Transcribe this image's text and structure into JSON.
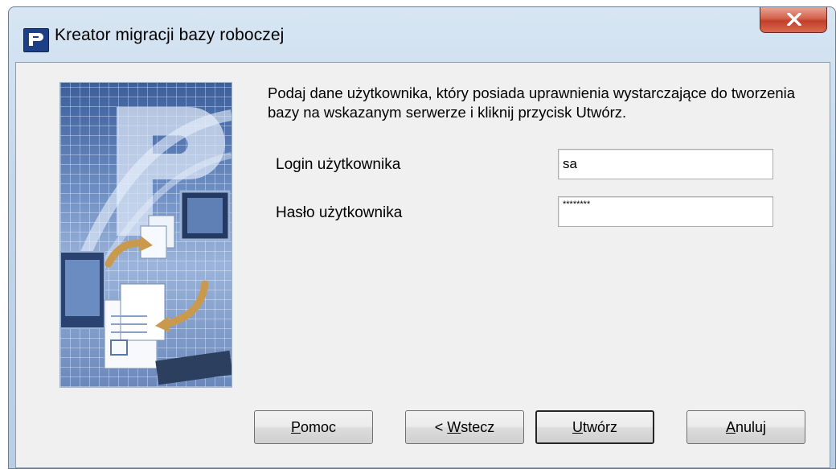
{
  "window": {
    "title": "Kreator migracji bazy roboczej",
    "close_label": "X"
  },
  "instructions": "Podaj dane użytkownika, który posiada uprawnienia wystarczające do tworzenia bazy na wskazanym serwerze i kliknij przycisk Utwórz.",
  "form": {
    "login_label": "Login użytkownika",
    "login_value": "sa",
    "password_label": "Hasło użytkownika",
    "password_value": "********"
  },
  "buttons": {
    "help": {
      "mnemonic": "P",
      "rest": "omoc"
    },
    "back": {
      "prefix": "< ",
      "mnemonic": "W",
      "rest": "stecz"
    },
    "create": {
      "mnemonic": "U",
      "rest": "twórz"
    },
    "cancel": {
      "mnemonic": "A",
      "rest": "nuluj"
    }
  },
  "colors": {
    "accent": "#1d3f85",
    "close": "#c1402a"
  }
}
